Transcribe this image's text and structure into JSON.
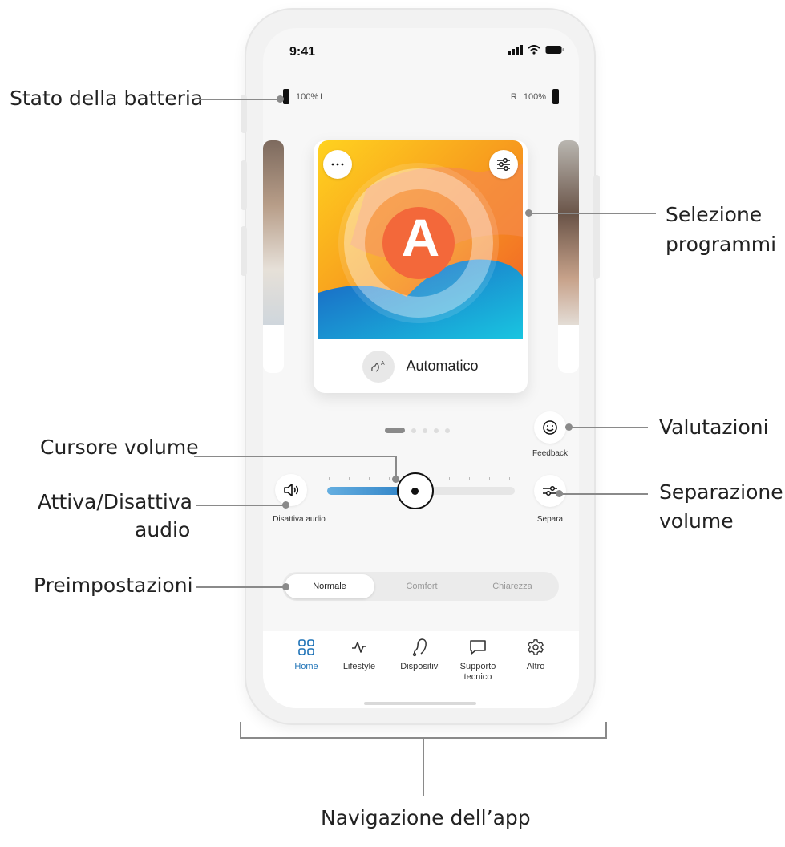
{
  "status": {
    "time": "9:41"
  },
  "battery": {
    "left": "100%",
    "left_side": "L",
    "right_side": "R",
    "right": "100%"
  },
  "program": {
    "letter": "A",
    "name": "Automatico"
  },
  "volume": {
    "level": 0.47
  },
  "labels": {
    "feedback": "Feedback",
    "mute": "Disattiva audio",
    "split": "Separa"
  },
  "presets": {
    "items": [
      "Normale",
      "Comfort",
      "Chiarezza"
    ],
    "selected": "Normale"
  },
  "nav": {
    "items": [
      "Home",
      "Lifestyle",
      "Dispositivi",
      "Supporto tecnico",
      "Altro"
    ],
    "active": "Home"
  },
  "annotations": {
    "battery": "Stato della batteria",
    "programs_1": "Selezione",
    "programs_2": "programmi",
    "ratings": "Valutazioni",
    "volume_cursor": "Cursore volume",
    "mute_1": "Attiva/Disattiva",
    "mute_2": "audio",
    "split_1": "Separazione",
    "split_2": "volume",
    "presets": "Preimpostazioni",
    "navigation": "Navigazione dell’app"
  },
  "colors": {
    "accent": "#1f73b7",
    "slider_fill": "#3a8fd0"
  }
}
